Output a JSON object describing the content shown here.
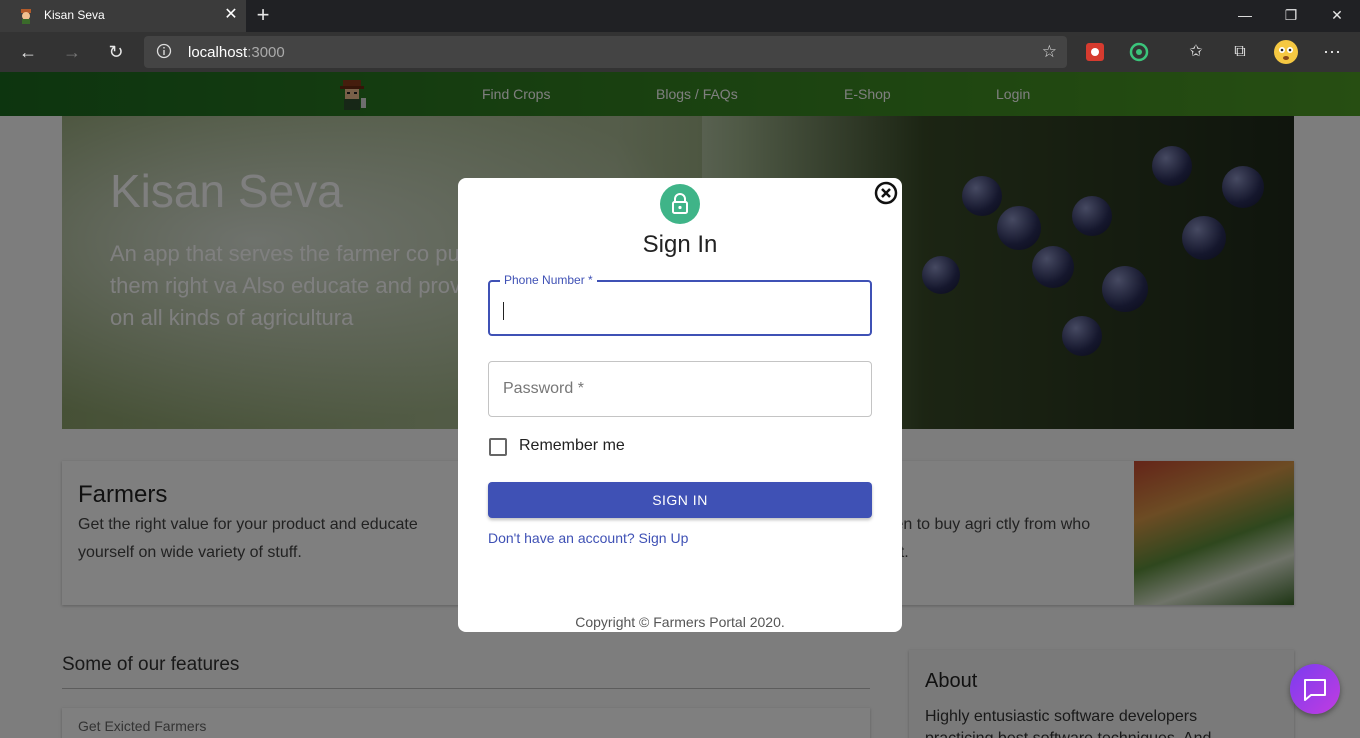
{
  "browser": {
    "tab_title": "Kisan Seva",
    "url_host": "localhost",
    "url_port": ":3000",
    "icons": {
      "back": "back-arrow-icon",
      "forward": "forward-arrow-icon",
      "reload": "reload-icon",
      "new_tab": "plus-icon",
      "close_tab": "close-icon"
    }
  },
  "nav": {
    "links": [
      "Find Crops",
      "Blogs / FAQs",
      "E-Shop",
      "Login"
    ]
  },
  "hero": {
    "title": "Kisan Seva",
    "text": "An app that serves the farmer co purpose of fetching them right va Also educate and provide best pr farmers on all kinds of agricultura"
  },
  "cards": {
    "farmers_title": "Farmers",
    "farmers_text": "Get the right value for your product and educate yourself on wide variety of stuff.",
    "buyers_text": "middlemen to buy agri ctly from who produce it."
  },
  "features": {
    "heading": "Some of our features",
    "item": "Get Exicted Farmers"
  },
  "about": {
    "title": "About",
    "text": "Highly entusiastic software developers practicing best software techniques. And"
  },
  "modal": {
    "title": "Sign In",
    "phone_label": "Phone Number *",
    "password_label": "Password *",
    "remember_label": "Remember me",
    "signin_label": "SIGN IN",
    "signup_link": "Don't have an account? Sign Up",
    "copyright": "Copyright © Farmers Portal 2020."
  },
  "colors": {
    "primary": "#3f51b5",
    "lock_avatar": "#3fb488",
    "nav_start": "#1b6a1f",
    "nav_end": "#4e9c24",
    "chat": "#9b3cec"
  }
}
